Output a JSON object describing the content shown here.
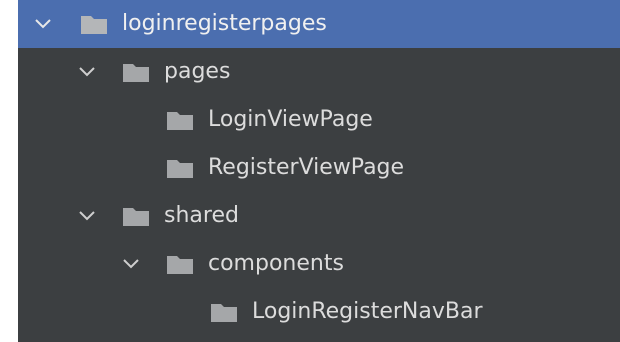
{
  "project_tree": {
    "colors": {
      "panel_background": "#3c3f41",
      "selected_row": "#4b6eaf",
      "text": "#dcdcdc",
      "folder": "#a5a7a9"
    },
    "nodes": [
      {
        "label": "loginregisterpages",
        "expanded": true,
        "selected": true,
        "icon": "folder-icon"
      },
      {
        "label": "pages",
        "expanded": true,
        "selected": false,
        "icon": "folder-icon"
      },
      {
        "label": "LoginViewPage",
        "expanded": false,
        "selected": false,
        "icon": "folder-icon"
      },
      {
        "label": "RegisterViewPage",
        "expanded": false,
        "selected": false,
        "icon": "folder-icon"
      },
      {
        "label": "shared",
        "expanded": true,
        "selected": false,
        "icon": "folder-icon"
      },
      {
        "label": "components",
        "expanded": true,
        "selected": false,
        "icon": "folder-icon"
      },
      {
        "label": "LoginRegisterNavBar",
        "expanded": false,
        "selected": false,
        "icon": "folder-icon"
      }
    ]
  }
}
